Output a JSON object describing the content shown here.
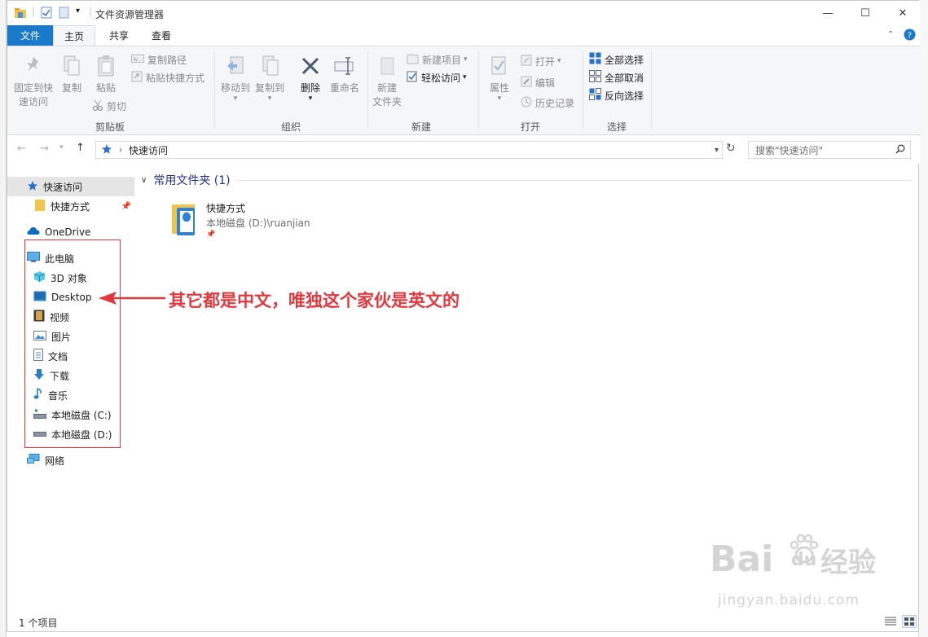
{
  "window": {
    "title": "文件资源管理器",
    "controls": {
      "minimize": "—",
      "maximize": "☐",
      "close": "✕"
    }
  },
  "tabs": [
    {
      "label": "文件"
    },
    {
      "label": "主页"
    },
    {
      "label": "共享"
    },
    {
      "label": "查看"
    }
  ],
  "ribbon": {
    "clipboard": {
      "label": "剪贴板",
      "pin": "固定到快\n速访问",
      "copy": "复制",
      "paste": "粘贴",
      "copy_path": "复制路径",
      "paste_shortcut": "粘贴快捷方式",
      "cut": "剪切"
    },
    "organize": {
      "label": "组织",
      "move_to": "移动到",
      "copy_to": "复制到",
      "delete": "删除",
      "rename": "重命名"
    },
    "new": {
      "label": "新建",
      "new_folder": "新建\n文件夹",
      "new_item": "新建项目",
      "easy_access": "轻松访问"
    },
    "open": {
      "label": "打开",
      "properties": "属性",
      "open": "打开",
      "edit": "编辑",
      "history": "历史记录"
    },
    "select": {
      "label": "选择",
      "select_all": "全部选择",
      "select_none": "全部取消",
      "invert": "反向选择"
    }
  },
  "address": {
    "path": "快速访问",
    "search_placeholder": "搜索\"快速访问\""
  },
  "nav": {
    "quick_access": "快速访问",
    "shortcuts": "快捷方式",
    "onedrive": "OneDrive",
    "this_pc": "此电脑",
    "objects3d": "3D 对象",
    "desktop": "Desktop",
    "videos": "视频",
    "pictures": "图片",
    "documents": "文档",
    "downloads": "下载",
    "music": "音乐",
    "drive_c": "本地磁盘 (C:)",
    "drive_d": "本地磁盘 (D:)",
    "network": "网络"
  },
  "content": {
    "group_header": "常用文件夹 (1)",
    "item_name": "快捷方式",
    "item_path": "本地磁盘 (D:)\\ruanjian"
  },
  "status": {
    "count": "1 个项目"
  },
  "annotation": {
    "text": "其它都是中文，唯独这个家伙是英文的"
  },
  "watermark": {
    "brand": "Bai",
    "brand2": "du",
    "brand_cn": "经验",
    "url": "jingyan.baidu.com"
  },
  "colors": {
    "accent": "#1979ca",
    "annotation": "#e0383e"
  }
}
